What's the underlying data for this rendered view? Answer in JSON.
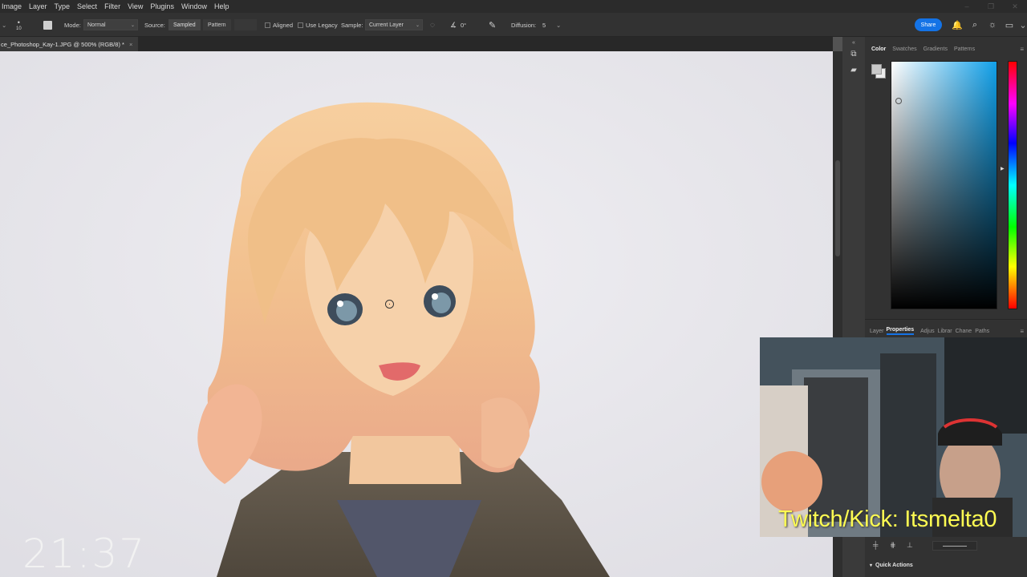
{
  "menu": [
    "Image",
    "Layer",
    "Type",
    "Select",
    "Filter",
    "View",
    "Plugins",
    "Window",
    "Help"
  ],
  "options": {
    "brush_size": "10",
    "mode_label": "Mode:",
    "mode_value": "Normal",
    "source_label": "Source:",
    "sampled_label": "Sampled",
    "pattern_label": "Pattern",
    "aligned_label": "Aligned",
    "use_legacy_label": "Use Legacy",
    "sample_label": "Sample:",
    "sample_value": "Current Layer",
    "angle_value": "0°",
    "diffusion_label": "Diffusion:",
    "diffusion_value": "5",
    "share_label": "Share"
  },
  "document": {
    "tab_title": "ce_Photoshop_Kay-1.JPG @ 500% (RGB/8) *",
    "close_glyph": "×"
  },
  "color_panel": {
    "tabs": [
      "Color",
      "Swatches",
      "Gradients",
      "Patterns"
    ],
    "active_tab": "Color",
    "picker_hue_color": "#11a0e9"
  },
  "lower_panel": {
    "tabs": [
      "Layer",
      "Properties",
      "Adjus",
      "Librar",
      "Chane",
      "Paths"
    ],
    "active_tab": "Properties",
    "quick_actions_label": "Quick Actions"
  },
  "overlay": {
    "stream_text": "Twitch/Kick: Itsmelta0",
    "stream_text_color": "#fdfb52",
    "timer": "21:37"
  },
  "colors": {
    "accent": "#1473e6",
    "canvas_bg": "#e9e8ec"
  }
}
